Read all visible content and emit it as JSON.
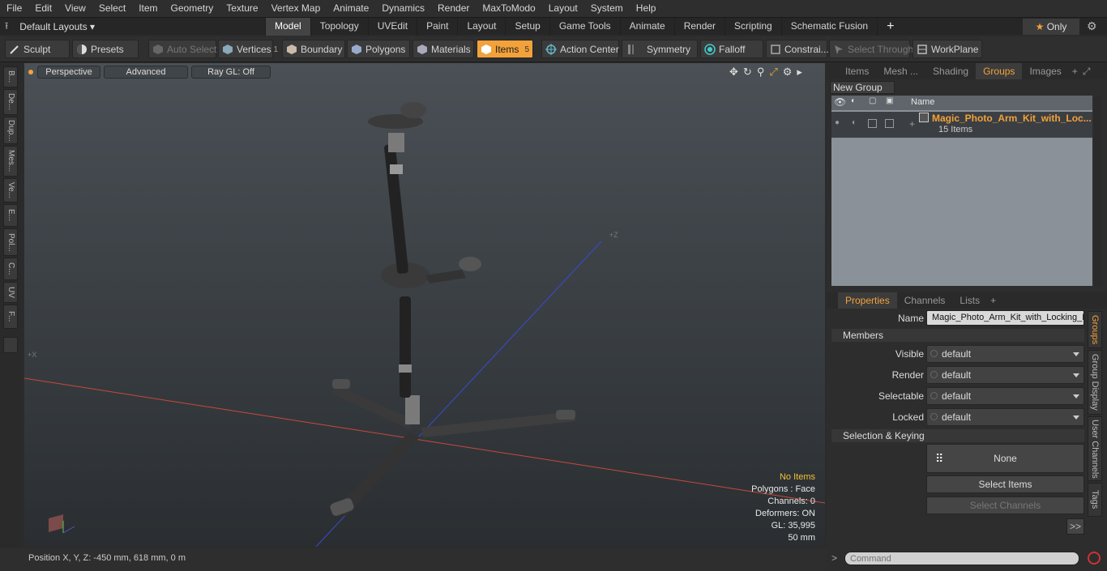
{
  "menu": [
    "File",
    "Edit",
    "View",
    "Select",
    "Item",
    "Geometry",
    "Texture",
    "Vertex Map",
    "Animate",
    "Dynamics",
    "Render",
    "MaxToModo",
    "Layout",
    "System",
    "Help"
  ],
  "layout": {
    "label": "Default Layouts"
  },
  "mode_tabs": [
    "Model",
    "Topology",
    "UVEdit",
    "Paint",
    "Layout",
    "Setup",
    "Game Tools",
    "Animate",
    "Render",
    "Scripting",
    "Schematic Fusion"
  ],
  "only": "Only",
  "toolbar": {
    "sculpt": "Sculpt",
    "presets": "Presets",
    "auto_select": "Auto Select",
    "vertices": "Vertices",
    "vertices_count": "1",
    "boundary": "Boundary",
    "polygons": "Polygons",
    "materials": "Materials",
    "items": "Items",
    "items_count": "5",
    "action_center": "Action Center",
    "symmetry": "Symmetry",
    "falloff": "Falloff",
    "constraints": "Constrai...",
    "select_through": "Select Through",
    "workplane": "WorkPlane"
  },
  "left_tabs": [
    "B...",
    "De...",
    "Dup...",
    "Mes...",
    "Ve...",
    "E...",
    "Pol...",
    "C...",
    "UV",
    "F..."
  ],
  "viewport": {
    "perspective": "Perspective",
    "advanced": "Advanced",
    "raygl": "Ray GL: Off",
    "stats": {
      "items": "No Items",
      "polygons": "Polygons : Face",
      "channels": "Channels: 0",
      "deformers": "Deformers: ON",
      "gl": "GL: 35,995",
      "scale": "50 mm"
    }
  },
  "status": {
    "position": "Position X, Y, Z:  -450 mm, 618 mm, 0 m"
  },
  "top_panel": {
    "tabs": [
      "Items",
      "Mesh ...",
      "Shading",
      "Groups",
      "Images"
    ],
    "new_group": "New Group",
    "name_col": "Name",
    "group_name": "Magic_Photo_Arm_Kit_with_Loc...",
    "group_count": "15 Items"
  },
  "props": {
    "tabs": [
      "Properties",
      "Channels",
      "Lists"
    ],
    "name_label": "Name",
    "name_value": "Magic_Photo_Arm_Kit_with_Locking_L",
    "members": "Members",
    "visible_label": "Visible",
    "render_label": "Render",
    "selectable_label": "Selectable",
    "locked_label": "Locked",
    "default_value": "default",
    "sel_keying": "Selection & Keying",
    "none": "None",
    "select_items": "Select Items",
    "select_channels": "Select Channels",
    "more": ">>",
    "side_tabs": [
      "Groups",
      "Group Display",
      "User Channels",
      "Tags"
    ]
  },
  "command": {
    "placeholder": "Command",
    "prompt": ">"
  },
  "colors": {
    "accent": "#f2a23b",
    "grid": "#8b9198"
  }
}
